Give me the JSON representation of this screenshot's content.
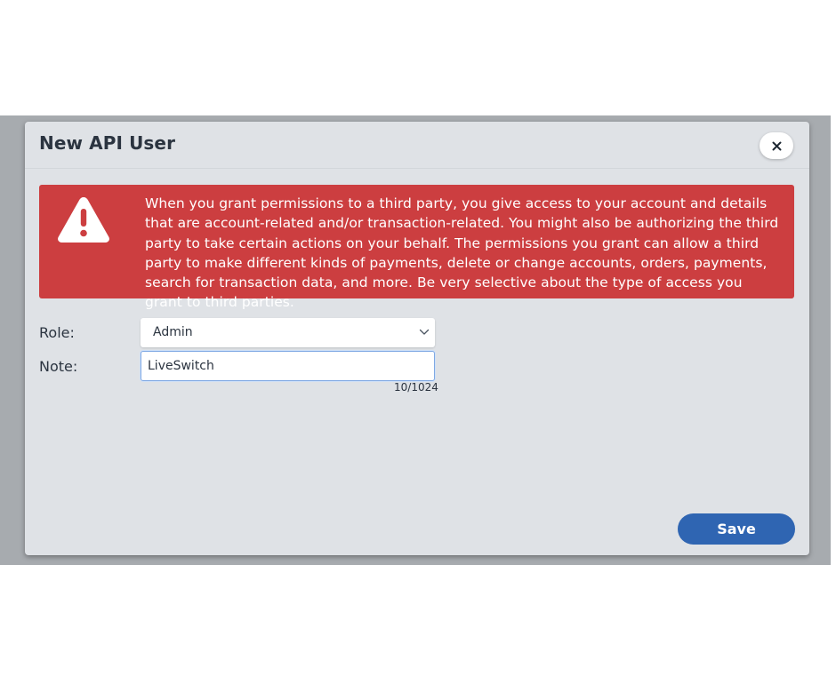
{
  "dialog": {
    "title": "New API User",
    "close_label": "×"
  },
  "alert": {
    "icon": "warning-triangle-icon",
    "message": "When you grant permissions to a third party, you give access to your account and details that are account-related and/or transaction-related. You might also be authorizing the third party to take certain actions on your behalf. The permissions you grant can allow a third party to make different kinds of payments, delete or change accounts, orders, payments, search for transaction data, and more. Be very selective about the type of access you grant to third parties.",
    "color": "#cc3e40"
  },
  "form": {
    "role_label": "Role:",
    "role_value": "Admin",
    "note_label": "Note:",
    "note_value": "LiveSwitch",
    "note_counter": "10/1024"
  },
  "actions": {
    "save_label": "Save",
    "save_color": "#2f65b2"
  }
}
